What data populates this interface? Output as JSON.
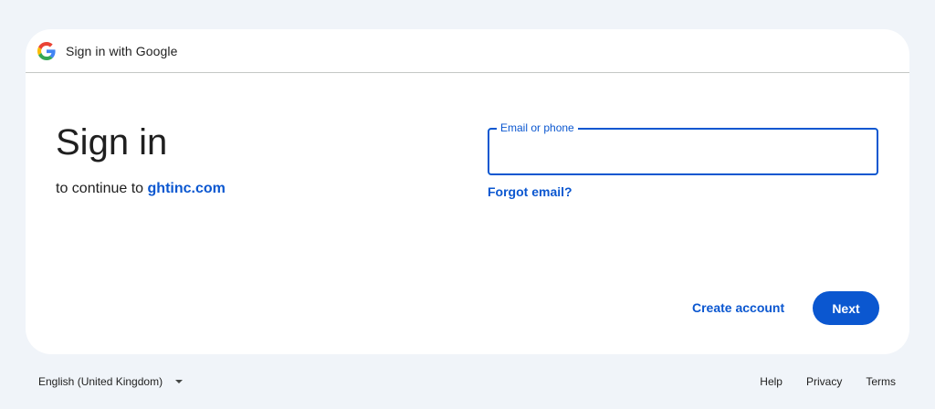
{
  "header": {
    "title": "Sign in with Google",
    "logo_icon": "google-g-icon"
  },
  "main": {
    "heading": "Sign in",
    "subtitle_prefix": "to continue to",
    "domain": "ghtinc.com"
  },
  "email_field": {
    "label": "Email or phone",
    "value": "",
    "placeholder": ""
  },
  "links": {
    "forgot_email": "Forgot email?"
  },
  "actions": {
    "create_account": "Create account",
    "next": "Next"
  },
  "footer": {
    "language": "English (United Kingdom)",
    "help": "Help",
    "privacy": "Privacy",
    "terms": "Terms"
  },
  "colors": {
    "accent": "#0b57d0",
    "page_background": "#f0f4f9",
    "card_background": "#ffffff"
  }
}
